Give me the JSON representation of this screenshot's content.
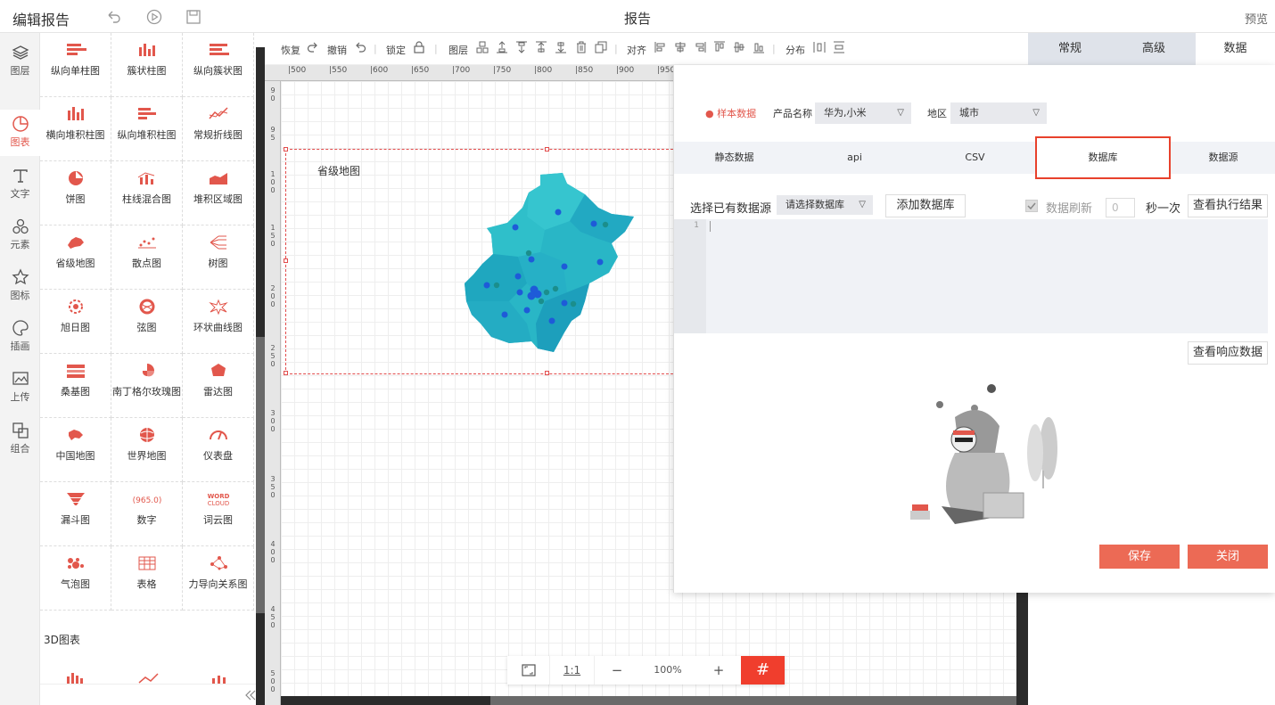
{
  "topbar": {
    "title": "编辑报告",
    "center": "报告",
    "preview": "预览"
  },
  "leftnav": [
    {
      "label": "图层",
      "icon": "layers-icon"
    },
    {
      "label": "图表",
      "icon": "chart-icon"
    },
    {
      "label": "文字",
      "icon": "text-icon"
    },
    {
      "label": "元素",
      "icon": "elements-icon"
    },
    {
      "label": "图标",
      "icon": "star-icon"
    },
    {
      "label": "插画",
      "icon": "palette-icon"
    },
    {
      "label": "上传",
      "icon": "upload-image-icon"
    },
    {
      "label": "组合",
      "icon": "group-icon"
    }
  ],
  "charts": [
    {
      "label": "纵向单柱图"
    },
    {
      "label": "簇状柱图"
    },
    {
      "label": "纵向簇状图"
    },
    {
      "label": "横向堆积柱图"
    },
    {
      "label": "纵向堆积柱图"
    },
    {
      "label": "常规折线图"
    },
    {
      "label": "饼图"
    },
    {
      "label": "柱线混合图"
    },
    {
      "label": "堆积区域图"
    },
    {
      "label": "省级地图"
    },
    {
      "label": "散点图"
    },
    {
      "label": "树图"
    },
    {
      "label": "旭日图"
    },
    {
      "label": "弦图"
    },
    {
      "label": "环状曲线图"
    },
    {
      "label": "桑基图"
    },
    {
      "label": "南丁格尔玫瑰图"
    },
    {
      "label": "雷达图"
    },
    {
      "label": "中国地图"
    },
    {
      "label": "世界地图"
    },
    {
      "label": "仪表盘"
    },
    {
      "label": "漏斗图"
    },
    {
      "label": "数字"
    },
    {
      "label": "词云图"
    },
    {
      "label": "气泡图"
    },
    {
      "label": "表格"
    },
    {
      "label": "力导向关系图"
    }
  ],
  "charts_extra": {
    "section_3d": "3D图表",
    "number_glyph": "965.0",
    "wordcloud_top": "WORD",
    "wordcloud_bottom": "CLOUD"
  },
  "toolbar": {
    "redo": "恢复",
    "undo": "撤销",
    "lock": "锁定",
    "layer": "图层",
    "align": "对齐",
    "distribute": "分布"
  },
  "ruler": {
    "h": [
      "500",
      "550",
      "600",
      "650",
      "700",
      "750",
      "800",
      "850",
      "900",
      "950"
    ]
  },
  "map_widget": {
    "label": "省级地图"
  },
  "zoom": {
    "fit": "",
    "ratio": "1:1",
    "minus": "−",
    "value": "100%",
    "plus": "+",
    "grid": "#"
  },
  "right_tabs": [
    {
      "label": "常规"
    },
    {
      "label": "高级"
    },
    {
      "label": "数据"
    }
  ],
  "dialog": {
    "sample_label": "样本数据",
    "product_label": "产品名称",
    "product_value": "华为,小米",
    "region_label": "地区",
    "region_value": "城市",
    "source_tabs": [
      {
        "label": "静态数据"
      },
      {
        "label": "api"
      },
      {
        "label": "CSV"
      },
      {
        "label": "数据库"
      },
      {
        "label": "数据源"
      }
    ],
    "choose_label": "选择已有数据源",
    "db_select": "请选择数据库",
    "add_db": "添加数据库",
    "refresh_label": "数据刷新",
    "refresh_value": "0",
    "per_label": "秒一次",
    "view_exec": "查看执行结果",
    "line_no": "1",
    "view_resp": "查看响应数据",
    "save": "保存",
    "close": "关闭"
  },
  "colors": {
    "accent": "#e2574c",
    "save_btn": "#ec6a55",
    "map_fill": "#29b6c6",
    "highlight": "#e8412c"
  }
}
